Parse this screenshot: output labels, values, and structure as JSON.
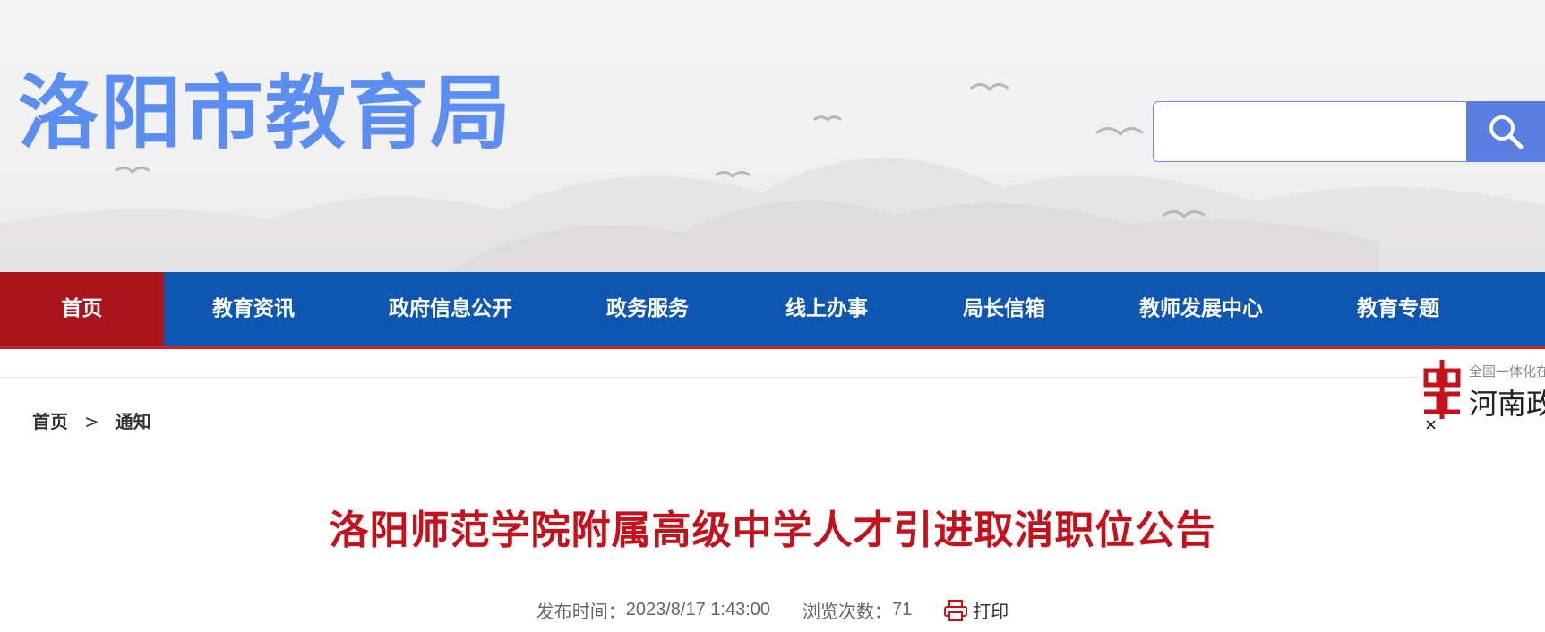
{
  "header": {
    "site_title": "洛阳市教育局",
    "search": {
      "placeholder": "",
      "value": ""
    },
    "search_icon": "search-icon"
  },
  "nav": {
    "items": [
      {
        "label": "首页",
        "active": true
      },
      {
        "label": "教育资讯"
      },
      {
        "label": "政府信息公开"
      },
      {
        "label": "政务服务"
      },
      {
        "label": "线上办事"
      },
      {
        "label": "局长信箱"
      },
      {
        "label": "教师发展中心"
      },
      {
        "label": "教育专题"
      }
    ]
  },
  "breadcrumb": {
    "home": "首页",
    "separator": ">",
    "current": "通知"
  },
  "article": {
    "title": "洛阳师范学院附属高级中学人才引进取消职位公告",
    "publish_label": "发布时间：",
    "publish_time": "2023/8/17 1:43:00",
    "views_label": "浏览次数：",
    "views": "71",
    "print_label": "打印"
  },
  "float_badge": {
    "small_text": "全国一体化在",
    "big_text": "河南政务",
    "close": "×"
  },
  "colors": {
    "title_blue": "#5b8ef0",
    "nav_blue": "#0e56b0",
    "nav_active_red": "#a8151d",
    "article_red": "#c3121c"
  }
}
